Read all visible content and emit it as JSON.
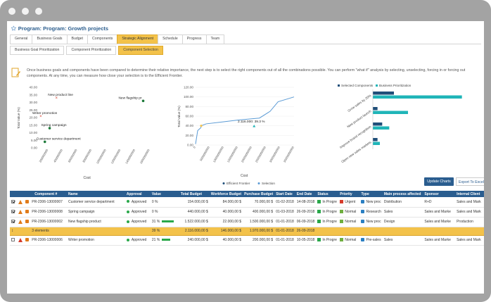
{
  "window": {
    "title": "Program: Program: Growth projects"
  },
  "tabs": [
    {
      "label": "General"
    },
    {
      "label": "Business Goals"
    },
    {
      "label": "Budget"
    },
    {
      "label": "Components"
    },
    {
      "label": "Strategic Alignment",
      "active": true
    },
    {
      "label": "Schedule"
    },
    {
      "label": "Progress"
    },
    {
      "label": "Team"
    }
  ],
  "subtabs": [
    {
      "label": "Business Goal Prioritization"
    },
    {
      "label": "Component Prioritization"
    },
    {
      "label": "Component Selection",
      "active": true
    }
  ],
  "info": {
    "text": "Once business goals and components have been compared to determine their relative importance, the next step is to select the right components out of all the combinations possible. You can perform \"what if\" analysis by selecting, unselecting, forcing in or forcing out components. At any time, you can measure how close your selection is to the Efficient Frontier."
  },
  "colors": {
    "accent": "#f3c24a",
    "brand": "#2a5d8f",
    "green": "#2aa84a",
    "teal": "#1fb5b8",
    "navy": "#1f4e79"
  },
  "chart_data": [
    {
      "type": "scatter",
      "xlabel": "Cost",
      "ylabel": "Total Value (%)",
      "ylim": [
        0,
        40
      ],
      "yticks": [
        "40.00",
        "35.00",
        "30.00",
        "25.00",
        "20.00",
        "15.00",
        "10.00",
        "5.00",
        "0.00"
      ],
      "xticks": [
        "200000000",
        "400000000",
        "600000000",
        "800000000",
        "1000000000",
        "1200000000",
        "1400000000",
        "1600000000"
      ],
      "xlim": [
        0,
        1700000000
      ],
      "points": [
        {
          "label": "New product line",
          "x": 250000000,
          "y": 33,
          "marker": "x"
        },
        {
          "label": "New flagship pr",
          "x": 1520000000,
          "y": 31,
          "marker": "dot"
        },
        {
          "label": "Writer promotion",
          "x": 20000000,
          "y": 21,
          "marker": "x"
        },
        {
          "label": "Spring campaign",
          "x": 150000000,
          "y": 13,
          "marker": "dot"
        },
        {
          "label": "Customer service department",
          "x": 80000000,
          "y": 4,
          "marker": "dot"
        }
      ]
    },
    {
      "type": "line",
      "xlabel": "Cost",
      "ylabel": "Total Value (%)",
      "ylim": [
        0,
        120
      ],
      "yticks": [
        "120.00",
        "100.00",
        "80.00",
        "60.00",
        "40.00",
        "20.00",
        "0.00"
      ],
      "xticks": [
        "0",
        "5000000000",
        "10000000000",
        "15000000000",
        "20000000000",
        "25000000000",
        "30000000000",
        "35000000000"
      ],
      "xlim": [
        0,
        37000000000
      ],
      "annotation": "2.116.000: 39.3 %",
      "series": [
        {
          "name": "Efficient Frontier",
          "x": [
            0,
            800000000,
            2000000000,
            2116000000,
            4000000000,
            10000000000,
            16000000000,
            24000000000,
            28000000000,
            31000000000,
            37000000000
          ],
          "y": [
            2,
            30,
            36,
            40,
            44,
            48,
            52,
            56,
            70,
            90,
            100
          ]
        },
        {
          "name": "Selection",
          "x": [
            22000000000
          ],
          "y": [
            39.3
          ]
        }
      ]
    },
    {
      "type": "bar",
      "orientation": "horizontal",
      "categories": [
        "Grow sales by 20%",
        "New product launch",
        "Improve brand recognition",
        "Open new sales markets"
      ],
      "series": [
        {
          "name": "Selected Components",
          "values": [
            0.09,
            0.02,
            0.04,
            0.02
          ]
        },
        {
          "name": "Business Prioritization",
          "values": [
            0.38,
            0.15,
            0.07,
            0.03
          ]
        }
      ],
      "xlim": [
        0,
        0.45
      ]
    }
  ],
  "buttons": {
    "update_charts": "Update Charts",
    "export": "Export To Excel"
  },
  "table": {
    "headers": [
      "Component #",
      "Name",
      "Approval",
      "Value",
      "Total Budget",
      "Workforce Budget",
      "Purchase Budget",
      "Start Date",
      "End Date",
      "Status",
      "Priority",
      "Type",
      "Main process affected",
      "Sponsor",
      "Internal Client"
    ],
    "rows": [
      {
        "selected": true,
        "warn": "orange",
        "id": "PR-2306-13000007",
        "name": "Customer service department",
        "approval": "Approved",
        "value": "0 %",
        "value_frac": 0,
        "total": "154.000,00 $",
        "workforce": "84.000,00 $",
        "purchase": "70.000,00 $",
        "start": "01-02-2018",
        "end": "14-08-2018",
        "status": "In Progre",
        "priority": "Urgent",
        "priority_red": true,
        "type": "New proc",
        "process": "Distribution",
        "sponsor": "R+D",
        "client": "Sales and Mark"
      },
      {
        "selected": true,
        "warn": "orange",
        "id": "PR-2306-13000008",
        "name": "Spring campaign",
        "approval": "Approved",
        "value": "0 %",
        "value_frac": 0,
        "total": "440.000,00 $",
        "workforce": "40.000,00 $",
        "purchase": "400.000,00 $",
        "start": "01-03-2018",
        "end": "26-09-2018",
        "status": "In Progre",
        "priority": "Normal",
        "priority_red": false,
        "type": "Research",
        "process": "Sales",
        "sponsor": "Sales and Marke",
        "client": "Sales and Mark"
      },
      {
        "selected": true,
        "warn": "orange",
        "id": "PR-2306-13000002",
        "name": "New flagship product",
        "approval": "Approved",
        "value": "31 %",
        "value_frac": 0.31,
        "total": "1.522.000,00 $",
        "workforce": "22.000,00 $",
        "purchase": "1.500.000,00 $",
        "start": "01-01-2018",
        "end": "06-09-2018",
        "status": "In Progre",
        "priority": "Normal",
        "priority_red": false,
        "type": "New proc",
        "process": "Design",
        "sponsor": "Sales and Marke",
        "client": "Production"
      }
    ],
    "summary": {
      "count": "3 elements",
      "value": "39 %",
      "total": "2.116.000,00 $",
      "workforce": "146.000,00 $",
      "purchase": "1.970.000,00 $",
      "start": "01-01-2018",
      "end": "26-09-2018"
    },
    "extra_rows": [
      {
        "selected": false,
        "warn": "red",
        "id": "PR-2306-13000006",
        "name": "Writer promotion",
        "approval": "Approved",
        "value": "21 %",
        "value_frac": 0.21,
        "total": "240.000,00 $",
        "workforce": "40.000,00 $",
        "purchase": "200.000,00 $",
        "start": "01-01-2018",
        "end": "10-05-2018",
        "status": "In Progre",
        "priority": "Normal",
        "priority_red": false,
        "type": "Pre-sales",
        "process": "Sales",
        "sponsor": "Sales and Marke",
        "client": "Sales and Mark"
      }
    ]
  }
}
